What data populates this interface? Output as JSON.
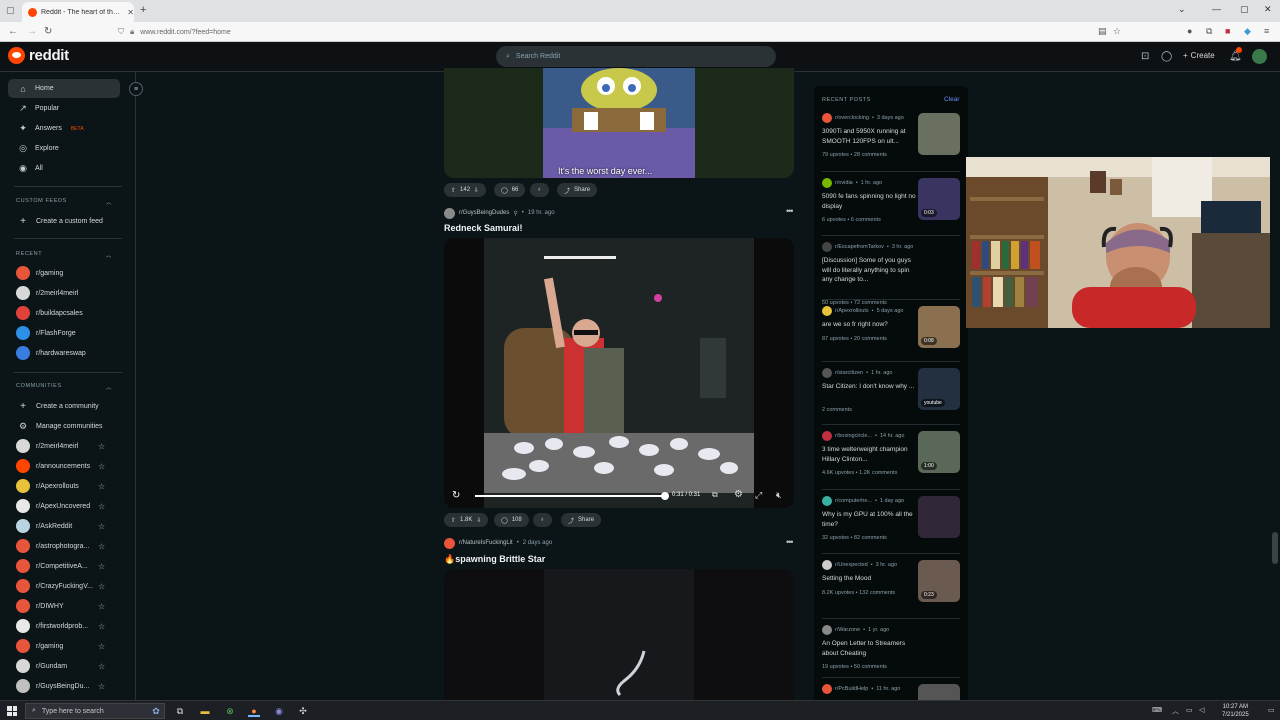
{
  "browser": {
    "tab_title": "Reddit - The heart of the intern",
    "new_tab": "+",
    "url": "www.reddit.com/?feed=home"
  },
  "header": {
    "logo_text": "reddit",
    "search_placeholder": "Search Reddit",
    "create_label": "Create",
    "notif_count": "2"
  },
  "sidebar": {
    "main": [
      {
        "label": "Home",
        "icon": "home-icon"
      },
      {
        "label": "Popular",
        "icon": "popular-icon"
      },
      {
        "label": "Answers",
        "icon": "answers-icon",
        "badge": "BETA"
      },
      {
        "label": "Explore",
        "icon": "explore-icon"
      },
      {
        "label": "All",
        "icon": "all-icon"
      }
    ],
    "custom_feeds_header": "CUSTOM FEEDS",
    "create_custom_feed": "Create a custom feed",
    "recent_header": "RECENT",
    "recent": [
      {
        "name": "r/gaming",
        "color": "#e8553b"
      },
      {
        "name": "r/2meirl4meirl",
        "color": "#d8d8d8"
      },
      {
        "name": "r/buildapcsales",
        "color": "#e0413b"
      },
      {
        "name": "r/FlashForge",
        "color": "#2c8fe8"
      },
      {
        "name": "r/hardwareswap",
        "color": "#3a7de0"
      }
    ],
    "communities_header": "COMMUNITIES",
    "create_community": "Create a community",
    "manage_communities": "Manage communities",
    "communities": [
      {
        "name": "r/2meirl4meirl",
        "color": "#d8d8d8"
      },
      {
        "name": "r/announcements",
        "color": "#ff4500"
      },
      {
        "name": "r/Apexrollouts",
        "color": "#e8c23b"
      },
      {
        "name": "r/ApexUncovered",
        "color": "#e8e8e8"
      },
      {
        "name": "r/AskReddit",
        "color": "#b8d4e0"
      },
      {
        "name": "r/astrophotogra...",
        "color": "#e8553b"
      },
      {
        "name": "r/CompetitiveA...",
        "color": "#e8553b"
      },
      {
        "name": "r/CrazyFuckingV...",
        "color": "#e8553b"
      },
      {
        "name": "r/DIWHY",
        "color": "#e8553b"
      },
      {
        "name": "r/firstworldprob...",
        "color": "#e8e8e8"
      },
      {
        "name": "r/gaming",
        "color": "#e8553b"
      },
      {
        "name": "r/Gundam",
        "color": "#d8d8d8"
      },
      {
        "name": "r/GuysBeingDu...",
        "color": "#c0c0c0"
      }
    ]
  },
  "feed": {
    "post1": {
      "caption": "It's the worst day ever...",
      "votes": "142",
      "comments": "66",
      "share": "Share"
    },
    "post2": {
      "subreddit": "r/GuysBeingDudes",
      "time": "19 hr. ago",
      "title": "Redneck Samurai!",
      "video_time": "0:31 / 0:31",
      "progress": 1.0,
      "votes": "1.8K",
      "comments": "108",
      "share": "Share"
    },
    "post3": {
      "subreddit": "r/NatureIsFuckingLit",
      "time": "2 days ago",
      "title": "🔥spawning Brittle Star"
    }
  },
  "recent_posts": {
    "header": "RECENT POSTS",
    "clear": "Clear",
    "items": [
      {
        "sub": "r/overclocking",
        "time": "3 days ago",
        "title": "3090Ti and 5950X running at SMOOTH 120FPS on ult...",
        "upvotes": "79 upvotes",
        "comments": "28 comments",
        "thumb": "#6a7060",
        "dur": "",
        "color": "#e8553b"
      },
      {
        "sub": "r/nvidia",
        "time": "1 hr. ago",
        "title": "5090 fe fans spinning no light no display",
        "upvotes": "6 upvotes",
        "comments": "6 comments",
        "thumb": "#3a3560",
        "dur": "0:03",
        "color": "#76b900"
      },
      {
        "sub": "r/EscapefromTarkov",
        "time": "3 hr. ago",
        "title": "[Discussion] Some of you guys will do literally anything to spin any change to...",
        "upvotes": "50 upvotes",
        "comments": "72 comments",
        "thumb": "",
        "dur": "",
        "color": "#444"
      },
      {
        "sub": "r/Apexrollouts",
        "time": "5 days ago",
        "title": "are we so fr right now?",
        "upvotes": "87 upvotes",
        "comments": "20 comments",
        "thumb": "#8a7050",
        "dur": "0:08",
        "color": "#e8c23b"
      },
      {
        "sub": "r/starcitizen",
        "time": "1 hr. ago",
        "title": "Star Citizen: I don't know why ...",
        "upvotes": "2 comments",
        "comments": "",
        "thumb": "#223040",
        "dur": "youtube",
        "color": "#555"
      },
      {
        "sub": "r/boxingcircle...",
        "time": "14 hr. ago",
        "title": "3 time welterweight champion Hillary Clinton...",
        "upvotes": "4.6K upvotes",
        "comments": "1.2K comments",
        "thumb": "#5a6858",
        "dur": "1:00",
        "color": "#c03040"
      },
      {
        "sub": "r/computerhe...",
        "time": "1 day ago",
        "title": "Why is my GPU at 100% all the time?",
        "upvotes": "32 upvotes",
        "comments": "82 comments",
        "thumb": "#302838",
        "dur": "",
        "color": "#3ab0a0"
      },
      {
        "sub": "r/Unexpected",
        "time": "3 hr. ago",
        "title": "Setting the Mood",
        "upvotes": "8.2K upvotes",
        "comments": "132 comments",
        "thumb": "#6a5a50",
        "dur": "0:23",
        "color": "#ccc"
      },
      {
        "sub": "r/Warzone",
        "time": "1 yr. ago",
        "title": "An Open Letter to Streamers about Cheating",
        "upvotes": "19 upvotes",
        "comments": "50 comments",
        "thumb": "",
        "dur": "",
        "color": "#888"
      },
      {
        "sub": "r/PcBuildHelp",
        "time": "11 hr. ago",
        "title": "",
        "upvotes": "",
        "comments": "",
        "thumb": "#555",
        "dur": "",
        "color": "#e8553b"
      }
    ]
  },
  "taskbar": {
    "search_placeholder": "Type here to search",
    "time": "10:27 AM",
    "date": "7/21/2025"
  }
}
